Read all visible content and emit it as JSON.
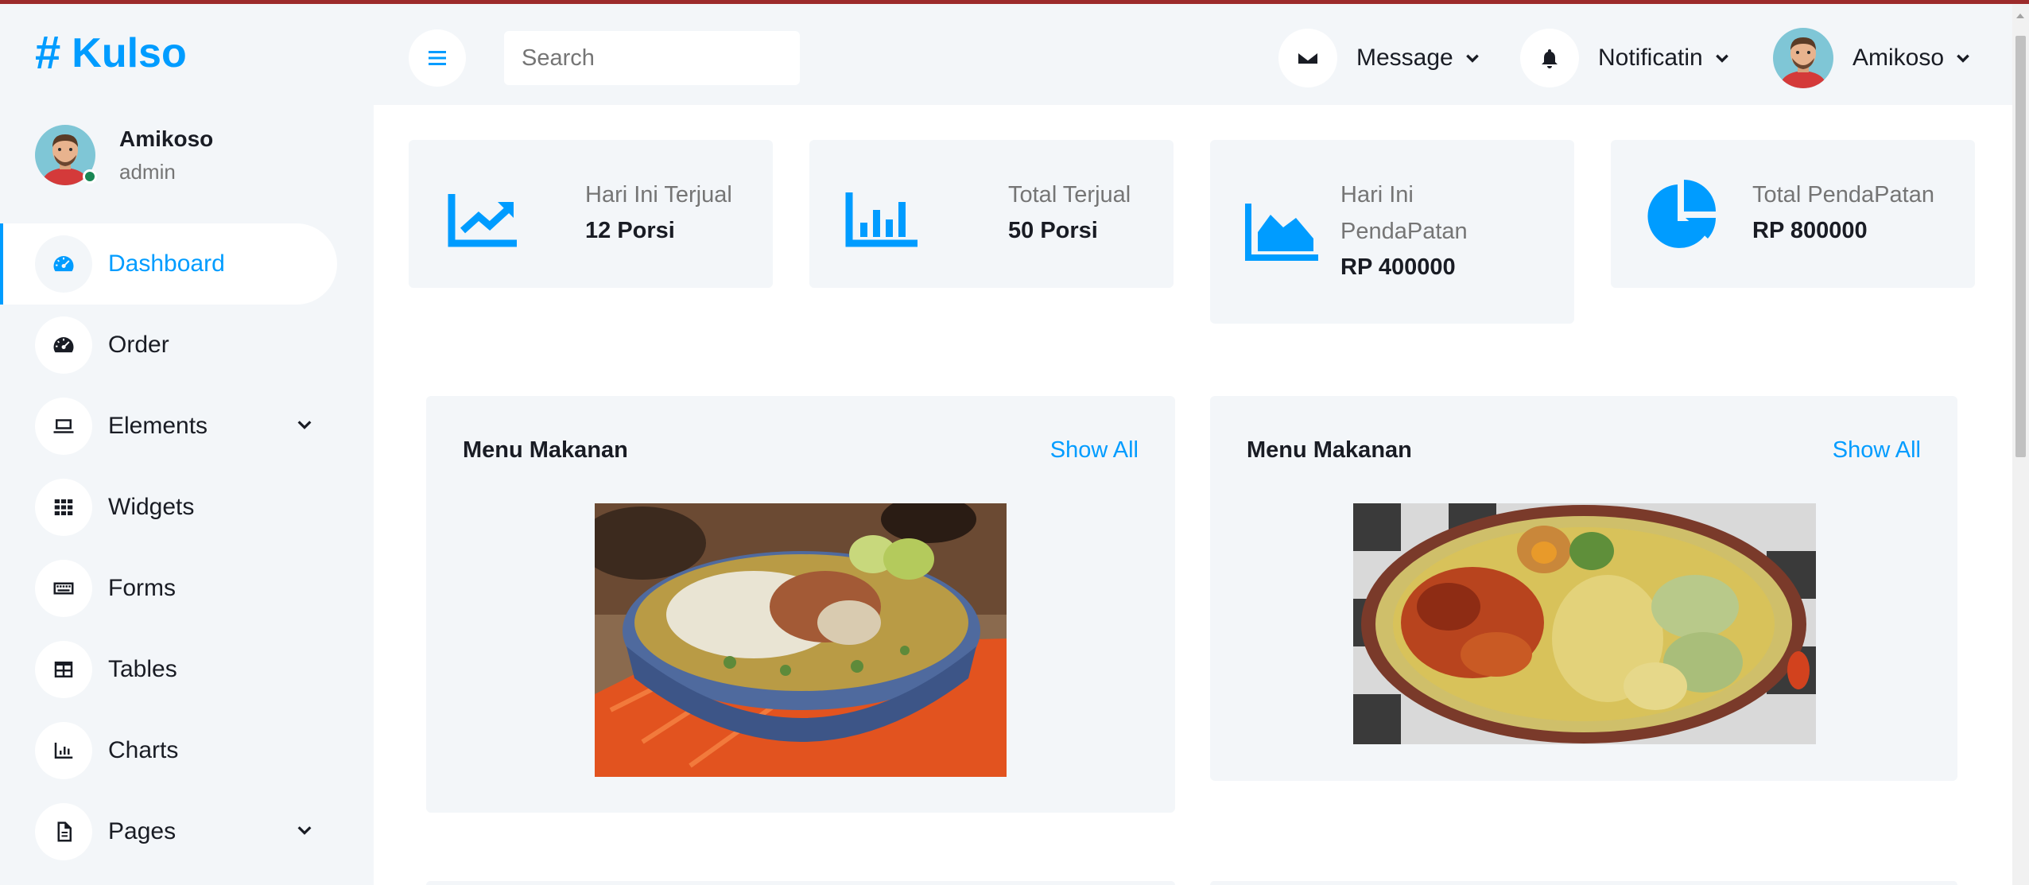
{
  "brand": {
    "hash": "#",
    "name": "Kulso"
  },
  "user": {
    "name": "Amikoso",
    "role": "admin"
  },
  "sidebar": {
    "items": [
      {
        "label": "Dashboard",
        "icon": "tachometer-icon",
        "active": true
      },
      {
        "label": "Order",
        "icon": "tachometer-icon"
      },
      {
        "label": "Elements",
        "icon": "laptop-icon",
        "has_submenu": true
      },
      {
        "label": "Widgets",
        "icon": "grid-icon"
      },
      {
        "label": "Forms",
        "icon": "keyboard-icon"
      },
      {
        "label": "Tables",
        "icon": "table-icon"
      },
      {
        "label": "Charts",
        "icon": "bar-chart-icon"
      },
      {
        "label": "Pages",
        "icon": "file-icon",
        "has_submenu": true
      }
    ]
  },
  "header": {
    "search_placeholder": "Search",
    "message_label": "Message",
    "notification_label": "Notificatin",
    "user_label": "Amikoso"
  },
  "stats": [
    {
      "label": "Hari Ini Terjual",
      "value": "12 Porsi",
      "icon": "line-chart-icon"
    },
    {
      "label": "Total Terjual",
      "value": "50 Porsi",
      "icon": "bar-chart-icon"
    },
    {
      "label": "Hari Ini PendaPatan",
      "value": "RP 400000",
      "icon": "area-chart-icon"
    },
    {
      "label": "Total PendaPatan",
      "value": "RP 800000",
      "icon": "pie-chart-icon"
    }
  ],
  "menus": [
    {
      "title": "Menu Makanan",
      "show_all": "Show All",
      "image": "soto-ayam-photo"
    },
    {
      "title": "Menu Makanan",
      "show_all": "Show All",
      "image": "lontong-sayur-photo"
    }
  ],
  "colors": {
    "primary": "#009cff",
    "light_bg": "#f3f6f9",
    "dark_text": "#191c24",
    "muted_text": "#757575",
    "online": "#198754"
  }
}
